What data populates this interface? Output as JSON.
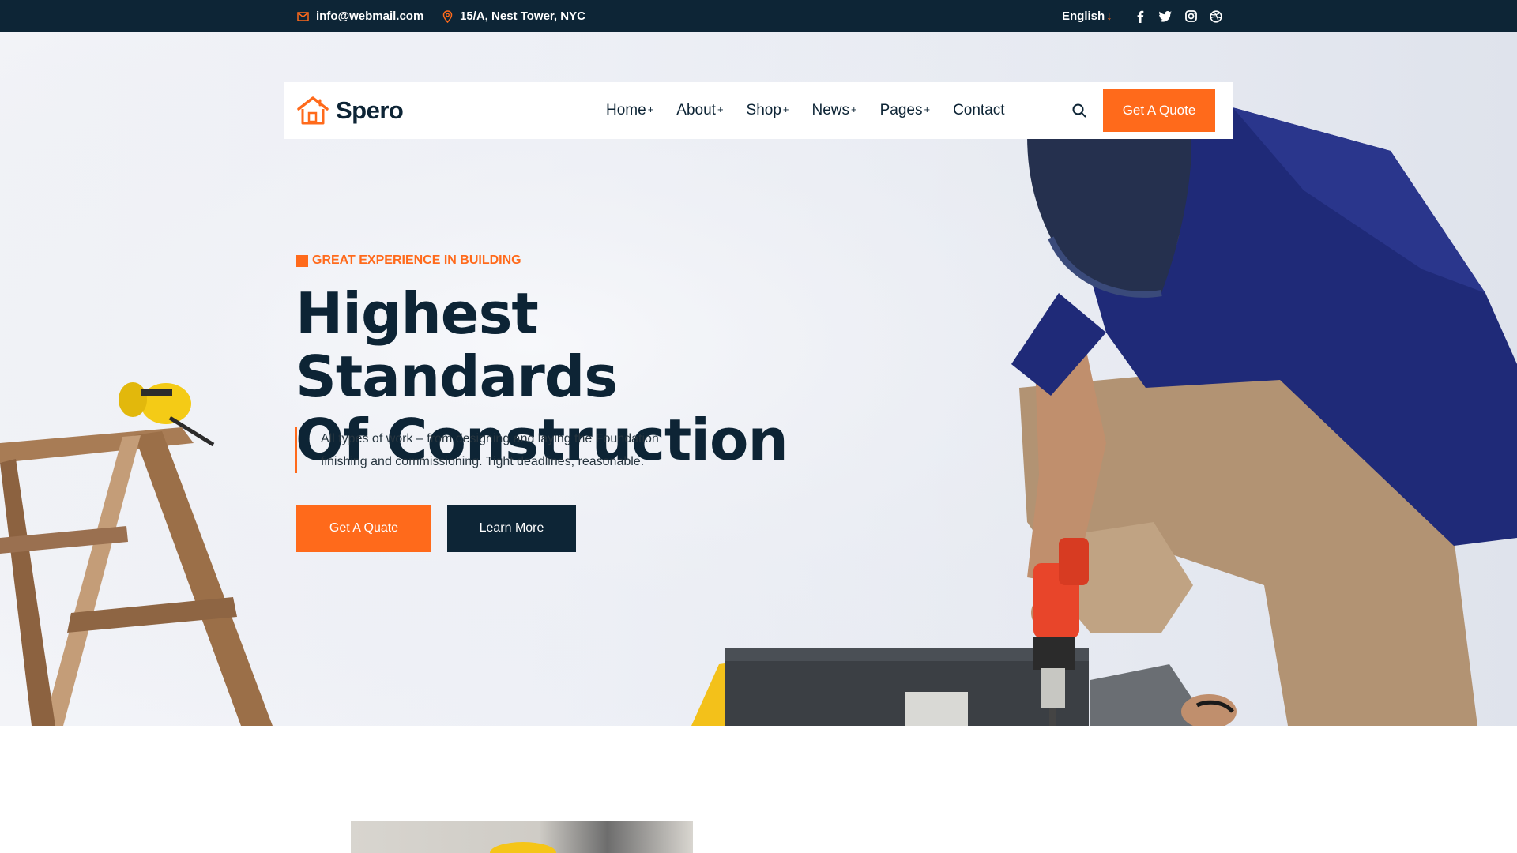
{
  "topbar": {
    "email": "info@webmail.com",
    "address": "15/A, Nest Tower, NYC",
    "language": "English",
    "language_arrow": "↓",
    "social": [
      "facebook-icon",
      "twitter-icon",
      "instagram-icon",
      "dribbble-icon"
    ]
  },
  "nav": {
    "logo_text": "Spero",
    "items": [
      {
        "label": "Home",
        "plus": "+"
      },
      {
        "label": "About",
        "plus": "+"
      },
      {
        "label": "Shop",
        "plus": "+"
      },
      {
        "label": "News",
        "plus": "+"
      },
      {
        "label": "Pages",
        "plus": "+"
      },
      {
        "label": "Contact",
        "plus": ""
      }
    ],
    "quote_label": "Get A Quote"
  },
  "hero": {
    "tagline": "GREAT EXPERIENCE IN BUILDING",
    "headline_line1": "Highest Standards",
    "headline_line2": "Of Construction",
    "desc_line1": "All types of work – from designing and laying the Foundation",
    "desc_line2": "finishing and commissioning. Tight deadlines, reasonable.",
    "btn_quote": "Get A Quate",
    "btn_learn": "Learn More"
  },
  "colors": {
    "accent": "#ff6a1b",
    "dark": "#0d2536"
  }
}
